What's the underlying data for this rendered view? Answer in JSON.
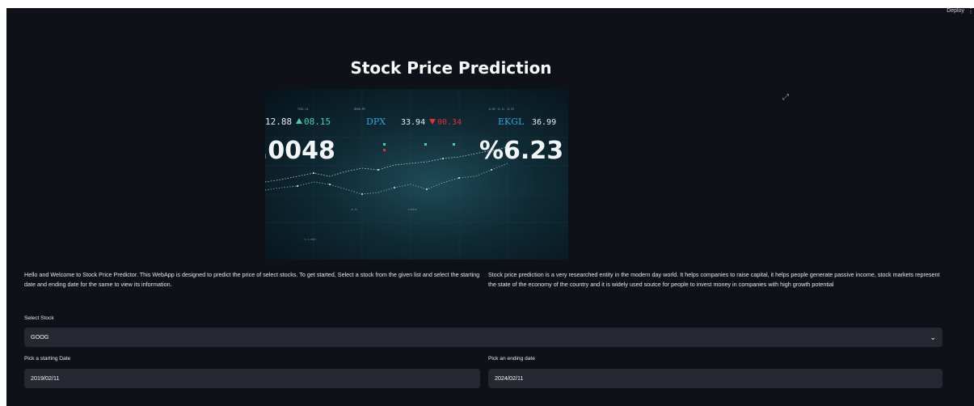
{
  "header": {
    "deploy_label": "Deploy",
    "menu_glyph": "⋮"
  },
  "page": {
    "title": "Stock Price Prediction"
  },
  "hero_image": {
    "ticker_1_value": "12.88",
    "ticker_1_change": "08.15",
    "ticker_2_symbol": "DPX",
    "ticker_2_value": "33.94",
    "ticker_2_change": "00.34",
    "ticker_3_symbol": "EKGL",
    "ticker_3_value": "36.99",
    "big_number_left": ".0048",
    "big_number_right": "%6.23",
    "colors": {
      "up": "#3fd1b8",
      "down": "#e0303a",
      "symbol": "#2fa6d9"
    }
  },
  "content": {
    "intro_text": "Hello and Welcome to Stock Price Predictor. This WebApp is designed to predict the price of select stocks. To get started, Select a stock from the given list and select the starting date and ending date for the same to view its information.",
    "about_text": "Stock price prediction is a very researched entity in the modern day world. It helps companies to raise capital, it helps people generate passive income, stock markets represent the state of the economy of the country and it is widely used soutce for people to invest money in companies with high growth potential"
  },
  "form": {
    "stock_label": "Select Stock",
    "stock_value": "GOOG",
    "start_label": "Pick a starting Date",
    "start_value": "2019/02/11",
    "end_label": "Pick an ending date",
    "end_value": "2024/02/11"
  },
  "theme": {
    "background": "#0e1117",
    "input_background": "#262730",
    "text": "#fafafa"
  }
}
